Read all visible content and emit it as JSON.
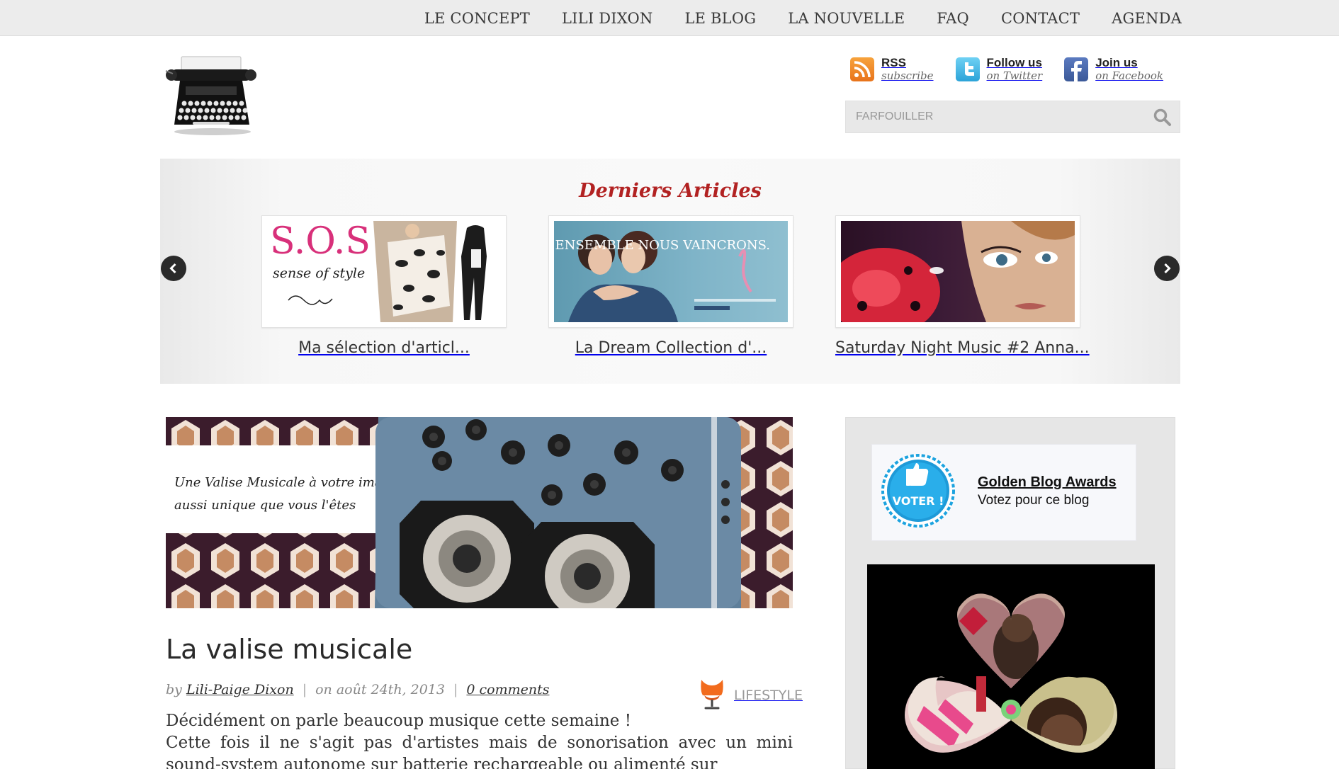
{
  "nav": {
    "items": [
      {
        "label": "LE CONCEPT"
      },
      {
        "label": "LILI DIXON"
      },
      {
        "label": "LE BLOG"
      },
      {
        "label": "LA NOUVELLE"
      },
      {
        "label": "FAQ"
      },
      {
        "label": "CONTACT"
      },
      {
        "label": "AGENDA"
      }
    ]
  },
  "social": {
    "rss": {
      "title": "RSS",
      "sub": "subscribe",
      "icon": "rss-icon"
    },
    "twitter": {
      "title": "Follow us",
      "sub": "on Twitter",
      "icon": "twitter-icon"
    },
    "facebook": {
      "title": "Join us",
      "sub": "on Facebook",
      "icon": "facebook-icon"
    }
  },
  "search": {
    "placeholder": "FARFOUILLER"
  },
  "carousel": {
    "title": "Derniers Articles",
    "slides": [
      {
        "caption": "Ma sélection d'articl...",
        "image_text": "S.O.S",
        "image_sub": "sense of style"
      },
      {
        "caption": "La Dream Collection d'...",
        "image_text": "ENSEMBLE NOUS VAINCRONS."
      },
      {
        "caption": "Saturday Night Music #2 Anna..."
      }
    ]
  },
  "featured": {
    "image_text_line1": "Une Valise Musicale à votre image,",
    "image_text_line2": "aussi unique que vous l'êtes"
  },
  "post": {
    "title": "La valise musicale",
    "by": "by",
    "author": "Lili-Paige Dixon",
    "date": "on août 24th, 2013",
    "comments": "0 comments",
    "category": "LIFESTYLE",
    "body_line1": "Décidément on parle beaucoup musique cette semaine !",
    "body_line2": "Cette fois il ne s'agit pas d'artistes mais de sonorisation avec un mini sound-system autonome sur batterie rechargeable ou alimenté sur"
  },
  "sidebar": {
    "award": {
      "badge_text": "VOTER !",
      "title": "Golden Blog Awards",
      "sub": "Votez pour ce blog"
    }
  },
  "colors": {
    "accent": "#b22222",
    "nav_bg": "#ececec",
    "rss": "#f08a24",
    "twitter": "#3fb5e6",
    "facebook": "#3b5998"
  }
}
